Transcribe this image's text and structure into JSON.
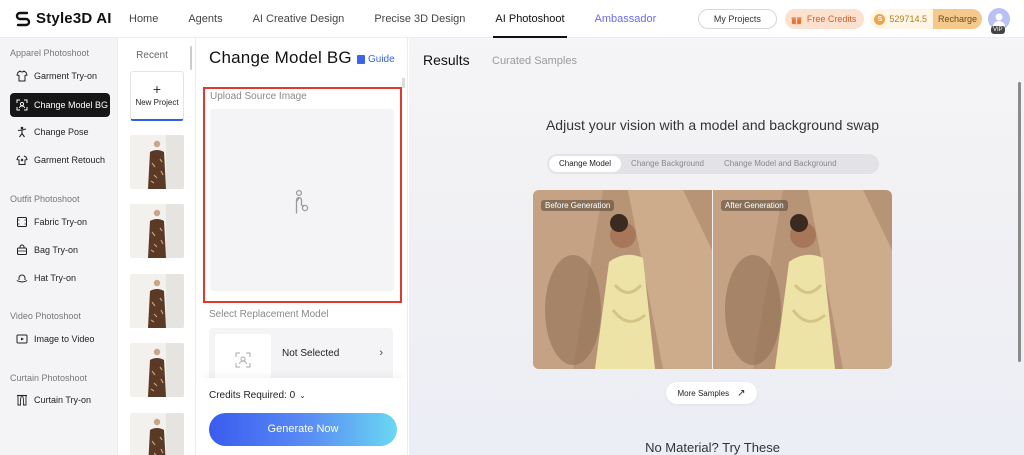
{
  "brand": {
    "name": "Style3D AI"
  },
  "nav": {
    "items": [
      "Home",
      "Agents",
      "AI Creative Design",
      "Precise 3D Design",
      "AI Photoshoot",
      "Ambassador"
    ],
    "active": "AI Photoshoot"
  },
  "top_right": {
    "my_projects": "My Projects",
    "free_credits": "Free Credits",
    "credits_value": "529714.5",
    "recharge": "Recharge",
    "vip": "VIP"
  },
  "sidebar": {
    "sections": [
      {
        "title": "Apparel Photoshoot",
        "items": [
          "Garment Try-on",
          "Change Model BG",
          "Change Pose",
          "Garment Retouch"
        ]
      },
      {
        "title": "Outfit Photoshoot",
        "items": [
          "Fabric Try-on",
          "Bag Try-on",
          "Hat Try-on"
        ]
      },
      {
        "title": "Video Photoshoot",
        "items": [
          "Image to Video"
        ]
      },
      {
        "title": "Curtain Photoshoot",
        "items": [
          "Curtain Try-on"
        ]
      }
    ],
    "active": "Change Model BG"
  },
  "recent": {
    "title": "Recent",
    "new_project": "New Project",
    "thumb_count": 5
  },
  "panel": {
    "title": "Change Model BG",
    "guide": "Guide",
    "upload_label": "Upload Source Image",
    "select_label": "Select Replacement Model",
    "select_value": "Not Selected",
    "credits_required": "Credits Required: 0",
    "generate": "Generate Now"
  },
  "main": {
    "tabs": [
      "Results",
      "Curated Samples"
    ],
    "active_tab": "Results",
    "headline": "Adjust your vision with a model and background swap",
    "segments": [
      "Change Model",
      "Change Background",
      "Change Model and Background"
    ],
    "active_segment": "Change Model",
    "before_label": "Before Generation",
    "after_label": "After Generation",
    "more_samples": "More Samples",
    "no_material": "No Material? Try These"
  },
  "colors": {
    "accent_blue": "#3a63f0",
    "highlight_red": "#e13a2c",
    "sidebar_active": "#161616",
    "ambassador": "#6b6bf2"
  }
}
